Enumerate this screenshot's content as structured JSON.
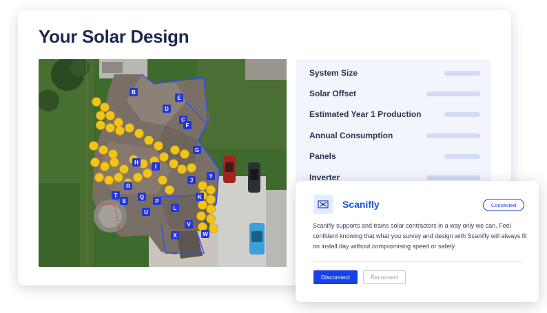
{
  "page": {
    "title": "Your Solar Design"
  },
  "specs": [
    {
      "label": "System Size"
    },
    {
      "label": "Solar Offset"
    },
    {
      "label": "Estimated Year 1 Production"
    },
    {
      "label": "Annual Consumption"
    },
    {
      "label": "Panels"
    },
    {
      "label": "Inverter"
    }
  ],
  "roof_labels": [
    "B",
    "D",
    "E",
    "C",
    "F",
    "G",
    "H",
    "I",
    "J",
    "R",
    "Y",
    "T",
    "S",
    "Q",
    "P",
    "K",
    "U",
    "L",
    "V",
    "X",
    "W"
  ],
  "integration": {
    "name": "Scanifly",
    "status": "Connected",
    "description": "Scanifly supports and trains solar contractors in a way only we can. Feel confident knowing that what you survey and design with Scanifly will always fit on install day without compromising speed or safety.",
    "disconnect_label": "Disconnect",
    "reconnect_label": "Reconnect",
    "logo_icon": "scanifly-logo-icon"
  },
  "colors": {
    "title": "#1b2a4e",
    "accent": "#1640e8",
    "panel_yellow": "#f2c318",
    "roof_outline": "#2b4cff",
    "lawn": "#3d6b2c"
  }
}
